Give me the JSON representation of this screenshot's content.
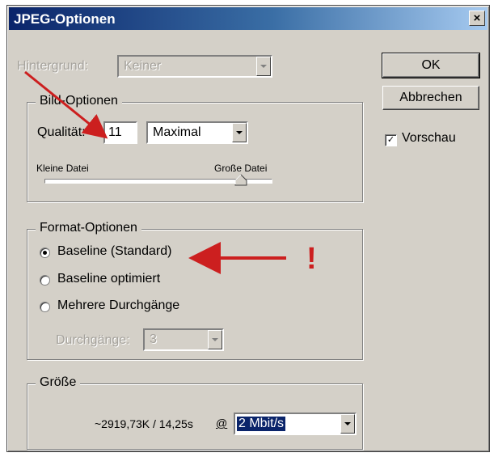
{
  "window": {
    "title": "JPEG-Optionen",
    "close_label": "×"
  },
  "hintergrund": {
    "label": "Hintergrund:",
    "value": "Keiner"
  },
  "bild_optionen": {
    "legend": "Bild-Optionen",
    "qualitaet_label": "Qualität:",
    "qualitaet_value": "11",
    "qualitaet_preset": "Maximal",
    "slider_left_label": "Kleine Datei",
    "slider_right_label": "Große Datei",
    "slider_level": 0.86
  },
  "format_optionen": {
    "legend": "Format-Optionen",
    "options": [
      "Baseline (Standard)",
      "Baseline optimiert",
      "Mehrere Durchgänge"
    ],
    "selected_index": 0,
    "durchgaenge_label": "Durchgänge:",
    "durchgaenge_value": "3"
  },
  "groesse": {
    "legend": "Größe",
    "estimate": "~2919,73K / 14,25s",
    "at_symbol": "@",
    "speed": "2 Mbit/s"
  },
  "buttons": {
    "ok": "OK",
    "cancel": "Abbrechen"
  },
  "vorschau": {
    "label": "Vorschau",
    "checked": true,
    "mark": "✓"
  },
  "annotation": {
    "exclamation": "!"
  },
  "colors": {
    "annotation_red": "#cc1f1f",
    "selection_blue": "#0a246a"
  }
}
